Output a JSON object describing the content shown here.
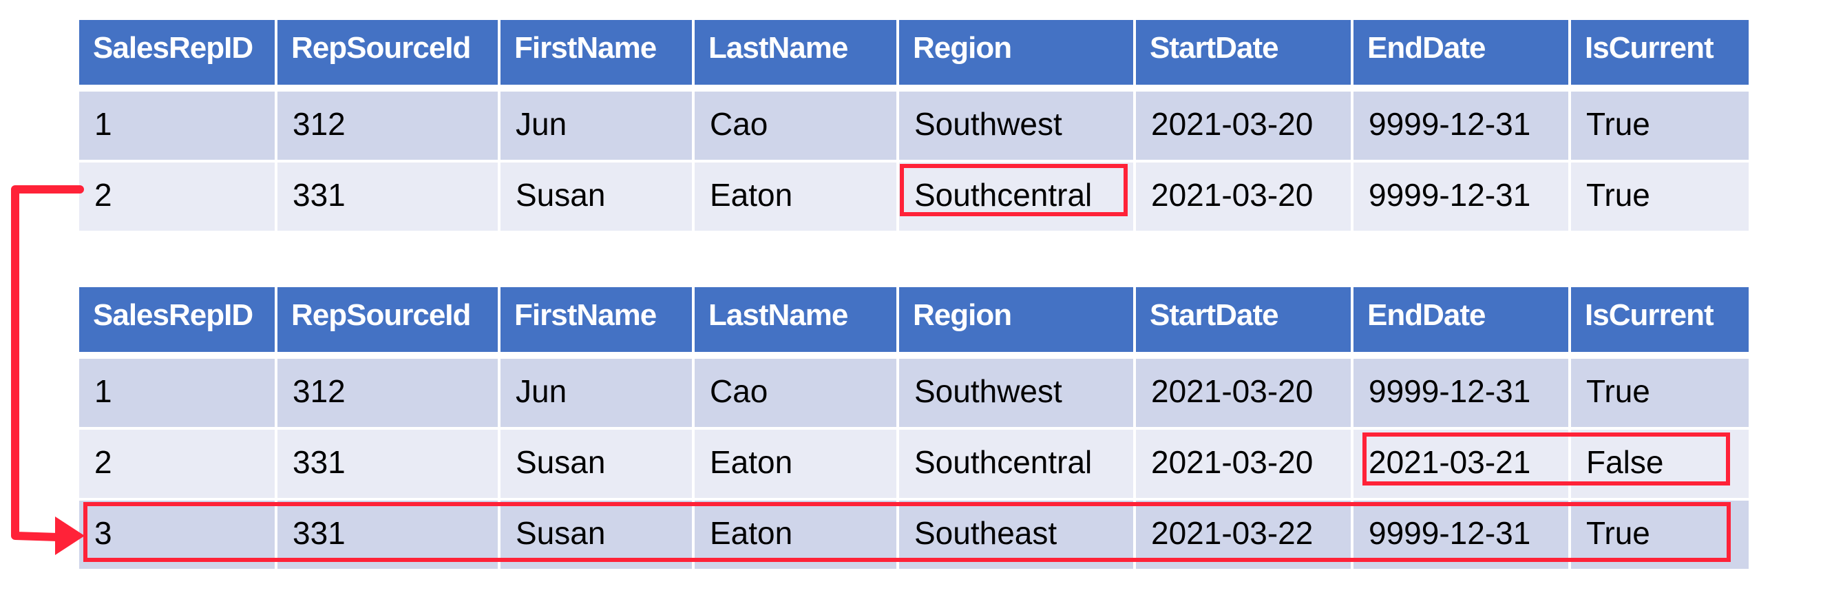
{
  "columns": [
    "SalesRepID",
    "RepSourceId",
    "FirstName",
    "LastName",
    "Region",
    "StartDate",
    "EndDate",
    "IsCurrent"
  ],
  "before_table": {
    "rows": [
      [
        "1",
        "312",
        "Jun",
        "Cao",
        "Southwest",
        "2021-03-20",
        "9999-12-31",
        "True"
      ],
      [
        "2",
        "331",
        "Susan",
        "Eaton",
        "Southcentral",
        "2021-03-20",
        "9999-12-31",
        "True"
      ]
    ]
  },
  "after_table": {
    "rows": [
      [
        "1",
        "312",
        "Jun",
        "Cao",
        "Southwest",
        "2021-03-20",
        "9999-12-31",
        "True"
      ],
      [
        "2",
        "331",
        "Susan",
        "Eaton",
        "Southcentral",
        "2021-03-20",
        "2021-03-21",
        "False"
      ],
      [
        "3",
        "331",
        "Susan",
        "Eaton",
        "Southeast",
        "2021-03-22",
        "9999-12-31",
        "True"
      ]
    ]
  },
  "highlights": {
    "changed_region_cell": "Southcentral",
    "expired_row_cells": [
      "2021-03-21",
      "False"
    ],
    "new_row": "3"
  },
  "colors": {
    "header": "#4472C4",
    "row_odd": "#CFD5EA",
    "row_even": "#E9EBF5",
    "highlight": "#FF2238"
  }
}
